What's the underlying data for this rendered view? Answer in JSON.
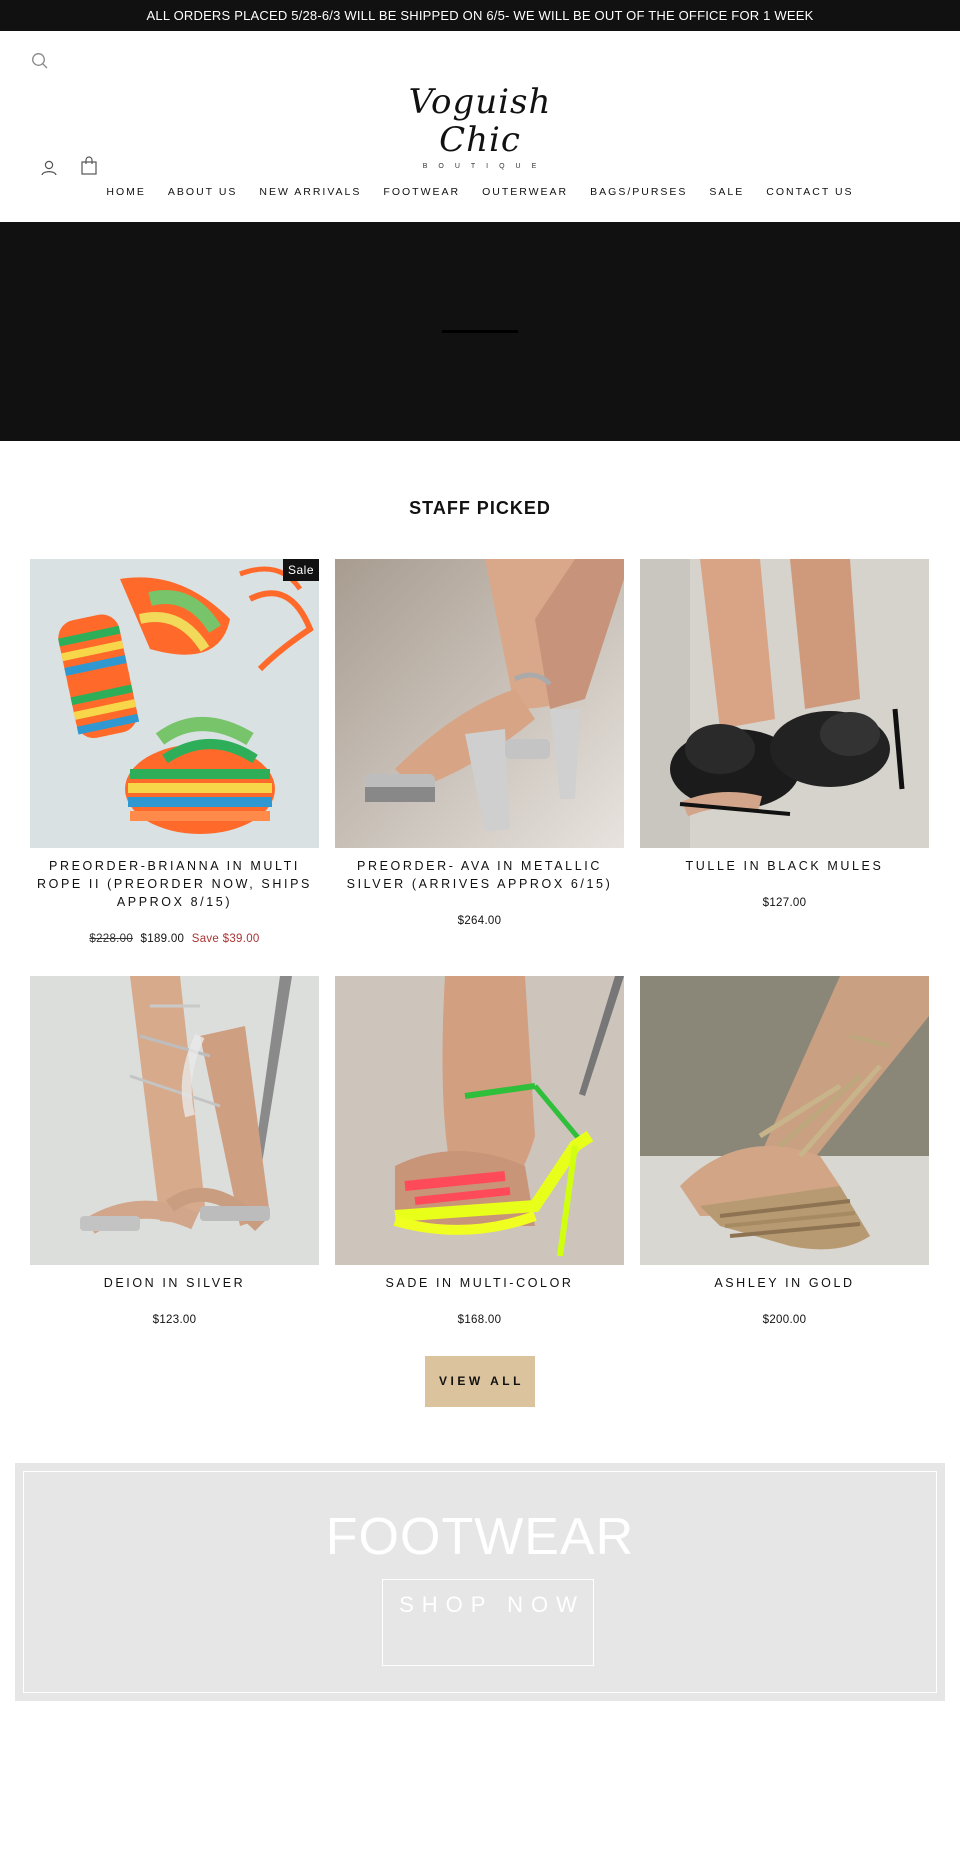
{
  "announcement": "ALL ORDERS PLACED 5/28-6/3 WILL BE SHIPPED ON 6/5- WE WILL BE OUT OF THE OFFICE FOR 1 WEEK",
  "header": {
    "logo_script": "Voguish Chic",
    "logo_sub": "BOUTIQUE",
    "icons": [
      "search-icon",
      "account-icon",
      "cart-icon"
    ]
  },
  "nav": [
    "HOME",
    "ABOUT US",
    "NEW ARRIVALS",
    "FOOTWEAR",
    "OUTERWEAR",
    "BAGS/PURSES",
    "SALE",
    "CONTACT US"
  ],
  "section_title": "STAFF PICKED",
  "products": [
    {
      "title": "PREORDER-BRIANNA IN MULTI ROPE II (PREORDER NOW, SHIPS APPROX 8/15)",
      "badge": "Sale",
      "old_price": "$228.00",
      "price": "$189.00",
      "save": "Save $39.00"
    },
    {
      "title": "PREORDER- AVA IN METALLIC SILVER (ARRIVES APPROX 6/15)",
      "price": "$264.00"
    },
    {
      "title": "TULLE IN BLACK MULES",
      "price": "$127.00"
    },
    {
      "title": "DEION IN SILVER",
      "price": "$123.00"
    },
    {
      "title": "SADE IN MULTI-COLOR",
      "price": "$168.00"
    },
    {
      "title": "ASHLEY IN GOLD",
      "price": "$200.00"
    }
  ],
  "view_all": "VIEW ALL",
  "promo": {
    "title": "FOOTWEAR",
    "button": "SHOP NOW"
  },
  "colors": {
    "dark": "#111111",
    "accent_button": "#dbc49d",
    "promo_bg": "#e6e6e6",
    "sale_red": "#aa3333"
  }
}
